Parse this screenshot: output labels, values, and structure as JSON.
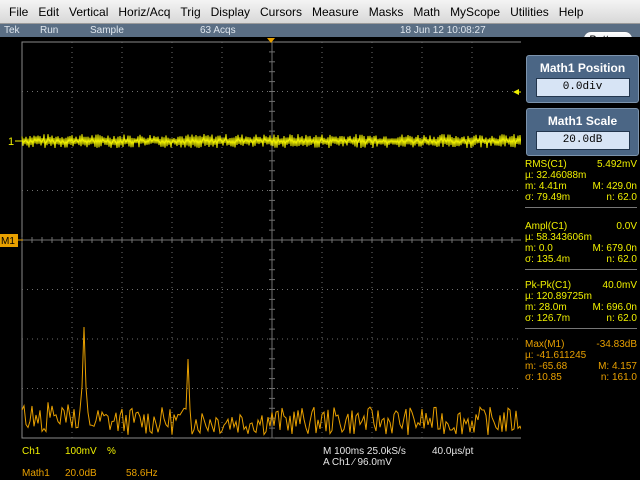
{
  "menu": [
    "File",
    "Edit",
    "Vertical",
    "Horiz/Acq",
    "Trig",
    "Display",
    "Cursors",
    "Measure",
    "Masks",
    "Math",
    "MyScope",
    "Utilities",
    "Help"
  ],
  "status": {
    "brand": "Tek",
    "run_state": "Run",
    "mode": "Sample",
    "acqs": "63 Acqs",
    "datetime": "18 Jun 12 10:08:27"
  },
  "buttons_label": "Buttons",
  "markers": {
    "ch1": "1",
    "math1": "M1"
  },
  "math1_position": {
    "title": "Math1 Position",
    "value": "0.0div"
  },
  "math1_scale": {
    "title": "Math1 Scale",
    "value": "20.0dB"
  },
  "measurements": [
    {
      "name": "RMS(C1)",
      "value": "5.492mV",
      "mu": "32.46088m",
      "m": "4.41m",
      "M": "429.0n",
      "sigma": "79.49m",
      "n": "62.0"
    },
    {
      "name": "Ampl(C1)",
      "value": "0.0V",
      "mu": "58.343606m",
      "m": "0.0",
      "M": "679.0n",
      "sigma": "135.4m",
      "n": "62.0"
    },
    {
      "name": "Pk-Pk(C1)",
      "value": "40.0mV",
      "mu": "120.89725m",
      "m": "28.0m",
      "M": "696.0n",
      "sigma": "126.7m",
      "n": "62.0"
    },
    {
      "name": "Max(M1)",
      "value": "-34.83dB",
      "mu": "-41.611245",
      "m": "-65.68",
      "M": "4.157",
      "sigma": "10.85",
      "n": "161.0"
    }
  ],
  "readout": {
    "ch1_label": "Ch1",
    "ch1_scale": "100mV",
    "ch1_coupling": "%",
    "math_label": "Math1",
    "math_scale": "20.0dB",
    "math_freq": "58.6Hz",
    "horizontal": "M 100ms 25.0kS/s",
    "resolution": "40.0µs/pt",
    "trigger": "A  Ch1  ⁄  96.0mV"
  },
  "colors": {
    "ch1": "#f0f000",
    "math": "#e8a000",
    "grid": "#707070",
    "background": "#000000",
    "panel": "#4b6685"
  }
}
